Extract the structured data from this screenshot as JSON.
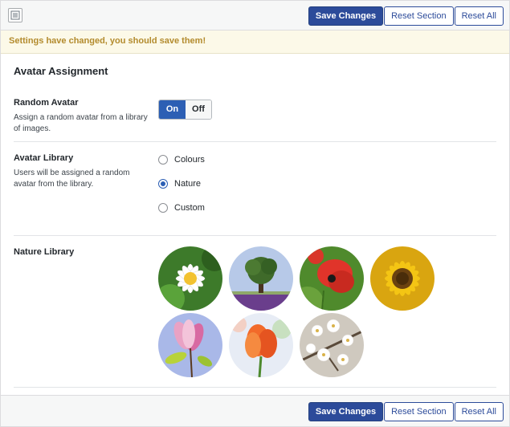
{
  "toolbar": {
    "save_label": "Save Changes",
    "reset_section_label": "Reset Section",
    "reset_all_label": "Reset All",
    "menu_icon": "list-icon"
  },
  "notice": "Settings have changed, you should save them!",
  "section_title": "Avatar Assignment",
  "random_avatar": {
    "label": "Random Avatar",
    "description": "Assign a random avatar from a library of images.",
    "on_label": "On",
    "off_label": "Off",
    "selected": "On"
  },
  "avatar_library": {
    "label": "Avatar Library",
    "description": "Users will be assigned a random avatar from the library.",
    "options": [
      "Colours",
      "Nature",
      "Custom"
    ],
    "selected": "Nature"
  },
  "nature_library": {
    "label": "Nature Library",
    "images": [
      "daisy-avatar",
      "tree-avatar",
      "poppy-avatar",
      "sunflower-avatar",
      "magnolia-avatar",
      "tulip-avatar",
      "blossom-avatar"
    ]
  },
  "colors": {
    "primary": "#2c4b9a",
    "toggle_on": "#2c5fb4",
    "notice_bg": "#fcf9e8",
    "notice_text": "#b38b2d"
  }
}
